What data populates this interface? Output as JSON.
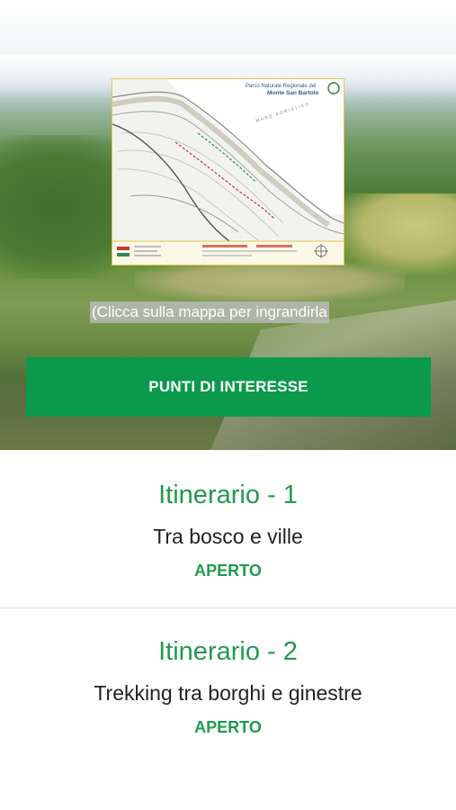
{
  "hero": {
    "map": {
      "header_line1": "Parco Naturale Regionale del",
      "header_line2": "Monte San Bartolo",
      "sea_label": "MARE ADRIATICO"
    },
    "caption": "(Clicca sulla mappa per ingrandirla",
    "poi_button_label": "PUNTI DI INTERESSE"
  },
  "itineraries": [
    {
      "title": "Itinerario - 1",
      "subtitle": "Tra bosco e ville",
      "status": "APERTO"
    },
    {
      "title": "Itinerario - 2",
      "subtitle": "Trekking tra borghi e ginestre",
      "status": "APERTO"
    }
  ],
  "colors": {
    "accent": "#0b9a4d",
    "title_green": "#1f9a4e",
    "map_border": "#e0c94a"
  }
}
